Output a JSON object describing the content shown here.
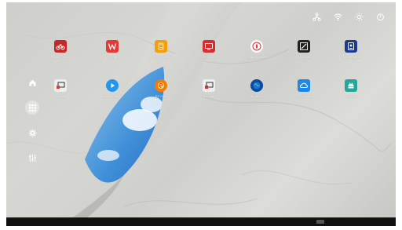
{
  "status_icons": [
    "network-icon",
    "wifi-icon",
    "brightness-icon",
    "power-icon"
  ],
  "sidebar": [
    "home-icon",
    "apps-grid-icon",
    "settings-icon",
    "equalizer-icon"
  ],
  "apps_row1": [
    {
      "label": "Speed Online",
      "name": "speed-online",
      "color": "#c62828",
      "icon": "bike"
    },
    {
      "label": "WPS Office",
      "name": "wps-office",
      "color": "#e53935",
      "icon": "w"
    },
    {
      "label": "CSF e-Viewing",
      "name": "csf-eviewing",
      "color": "#f59e0b",
      "icon": "doc"
    },
    {
      "label": "E-play",
      "name": "e-play",
      "color": "#d32f2f",
      "icon": "screen"
    },
    {
      "label": "Cloud Browser",
      "name": "cloud-browser",
      "color": "#ffffff",
      "icon": "compass"
    },
    {
      "label": "Annotate",
      "name": "annotate",
      "color": "#222222",
      "icon": "pen"
    },
    {
      "label": "Smart Badge",
      "name": "smart-badge",
      "color": "#1e3a8a",
      "icon": "card"
    }
  ],
  "apps_row2": [
    {
      "label": "Display",
      "name": "display",
      "color": "#eeeeee",
      "icon": "cast"
    },
    {
      "label": "Media Player",
      "name": "media-player",
      "color": "#2196f3",
      "icon": "play"
    },
    {
      "label": "EZ Cast",
      "name": "ez-cast",
      "color": "#f57c00",
      "icon": "e"
    },
    {
      "label": "Manage",
      "name": "manage",
      "color": "#eeeeee",
      "icon": "cast2"
    },
    {
      "label": "Browser",
      "name": "browser",
      "color": "#0d47a1",
      "icon": "globe"
    },
    {
      "label": "OPS Capture",
      "name": "ops-capture",
      "color": "#1e88e5",
      "icon": "cloud"
    },
    {
      "label": "AppStore",
      "name": "app-store",
      "color": "#26a69a",
      "icon": "android"
    }
  ]
}
